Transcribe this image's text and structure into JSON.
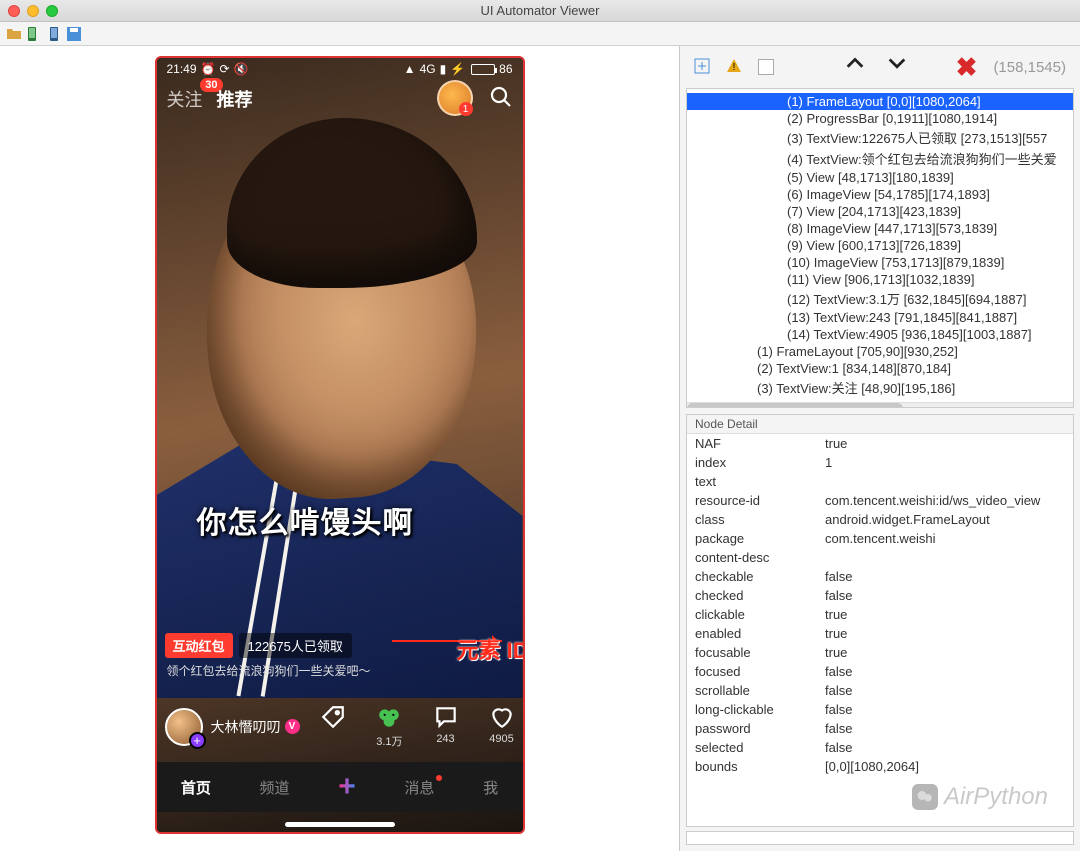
{
  "window": {
    "title": "UI Automator Viewer"
  },
  "device": {
    "statusbar": {
      "time": "21:49",
      "battery_pct": "86",
      "net_label": "4G"
    },
    "topnav": {
      "follow": "关注",
      "recommend": "推荐",
      "follow_badge": "30",
      "gift_badge": "1"
    },
    "caption": "你怎么啃馒头啊",
    "redpacket": {
      "tag": "互动红包",
      "count_text": "122675人已领取",
      "subtitle": "领个红包去给流浪狗狗们一些关爱吧～"
    },
    "author": {
      "name": "大林憯叨叨"
    },
    "actions": {
      "share": {
        "count": "3.1万"
      },
      "comment": {
        "count": "243"
      },
      "like": {
        "count": "4905"
      }
    },
    "bottombar": {
      "home": "首页",
      "channel": "频道",
      "message": "消息",
      "me": "我"
    }
  },
  "annotation": {
    "text": "元素 ID 不存在"
  },
  "right": {
    "coords": "(158,1545)",
    "tree": [
      {
        "lvl": 0,
        "sel": true,
        "text": "(1) FrameLayout [0,0][1080,2064]"
      },
      {
        "lvl": 0,
        "sel": false,
        "text": "(2) ProgressBar [0,1911][1080,1914]"
      },
      {
        "lvl": 0,
        "sel": false,
        "text": "(3) TextView:122675人已领取 [273,1513][557"
      },
      {
        "lvl": 0,
        "sel": false,
        "text": "(4) TextView:领个红包去给流浪狗狗们一些关爱"
      },
      {
        "lvl": 0,
        "sel": false,
        "text": "(5) View [48,1713][180,1839]"
      },
      {
        "lvl": 0,
        "sel": false,
        "text": "(6) ImageView [54,1785][174,1893]"
      },
      {
        "lvl": 0,
        "sel": false,
        "text": "(7) View [204,1713][423,1839]"
      },
      {
        "lvl": 0,
        "sel": false,
        "text": "(8) ImageView [447,1713][573,1839]"
      },
      {
        "lvl": 0,
        "sel": false,
        "text": "(9) View [600,1713][726,1839]"
      },
      {
        "lvl": 0,
        "sel": false,
        "text": "(10) ImageView [753,1713][879,1839]"
      },
      {
        "lvl": 0,
        "sel": false,
        "text": "(11) View [906,1713][1032,1839]"
      },
      {
        "lvl": 0,
        "sel": false,
        "text": "(12) TextView:3.1万 [632,1845][694,1887]"
      },
      {
        "lvl": 0,
        "sel": false,
        "text": "(13) TextView:243 [791,1845][841,1887]"
      },
      {
        "lvl": 0,
        "sel": false,
        "text": "(14) TextView:4905 [936,1845][1003,1887]"
      },
      {
        "lvl": 1,
        "sel": false,
        "text": "(1) FrameLayout [705,90][930,252]"
      },
      {
        "lvl": 1,
        "sel": false,
        "text": "(2) TextView:1 [834,148][870,184]"
      },
      {
        "lvl": 1,
        "sel": false,
        "text": "(3) TextView:关注 [48,90][195,186]"
      }
    ],
    "detail_header": "Node Detail",
    "detail": [
      {
        "k": "NAF",
        "v": "true"
      },
      {
        "k": "index",
        "v": "1"
      },
      {
        "k": "text",
        "v": ""
      },
      {
        "k": "resource-id",
        "v": "com.tencent.weishi:id/ws_video_view"
      },
      {
        "k": "class",
        "v": "android.widget.FrameLayout"
      },
      {
        "k": "package",
        "v": "com.tencent.weishi"
      },
      {
        "k": "content-desc",
        "v": ""
      },
      {
        "k": "checkable",
        "v": "false"
      },
      {
        "k": "checked",
        "v": "false"
      },
      {
        "k": "clickable",
        "v": "true"
      },
      {
        "k": "enabled",
        "v": "true"
      },
      {
        "k": "focusable",
        "v": "true"
      },
      {
        "k": "focused",
        "v": "false"
      },
      {
        "k": "scrollable",
        "v": "false"
      },
      {
        "k": "long-clickable",
        "v": "false"
      },
      {
        "k": "password",
        "v": "false"
      },
      {
        "k": "selected",
        "v": "false"
      },
      {
        "k": "bounds",
        "v": "[0,0][1080,2064]"
      }
    ]
  },
  "watermark": "AirPython"
}
